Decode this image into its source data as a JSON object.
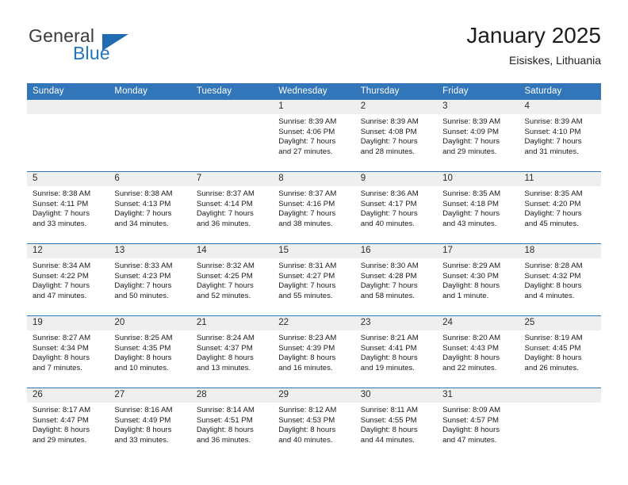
{
  "brand": {
    "name_top": "General",
    "name_bottom": "Blue",
    "triangle_color": "#1f6cb0",
    "blue_text_color": "#2176bd"
  },
  "header": {
    "title": "January 2025",
    "subtitle": "Eisiskes, Lithuania"
  },
  "theme": {
    "header_blue": "#3275b8",
    "row_separator": "#2f74b4",
    "daynum_background": "#efefef"
  },
  "weekday_headers": [
    "Sunday",
    "Monday",
    "Tuesday",
    "Wednesday",
    "Thursday",
    "Friday",
    "Saturday"
  ],
  "weeks": [
    [
      {
        "day": "",
        "lines": []
      },
      {
        "day": "",
        "lines": []
      },
      {
        "day": "",
        "lines": []
      },
      {
        "day": "1",
        "lines": [
          "Sunrise: 8:39 AM",
          "Sunset: 4:06 PM",
          "Daylight: 7 hours",
          "and 27 minutes."
        ]
      },
      {
        "day": "2",
        "lines": [
          "Sunrise: 8:39 AM",
          "Sunset: 4:08 PM",
          "Daylight: 7 hours",
          "and 28 minutes."
        ]
      },
      {
        "day": "3",
        "lines": [
          "Sunrise: 8:39 AM",
          "Sunset: 4:09 PM",
          "Daylight: 7 hours",
          "and 29 minutes."
        ]
      },
      {
        "day": "4",
        "lines": [
          "Sunrise: 8:39 AM",
          "Sunset: 4:10 PM",
          "Daylight: 7 hours",
          "and 31 minutes."
        ]
      }
    ],
    [
      {
        "day": "5",
        "lines": [
          "Sunrise: 8:38 AM",
          "Sunset: 4:11 PM",
          "Daylight: 7 hours",
          "and 33 minutes."
        ]
      },
      {
        "day": "6",
        "lines": [
          "Sunrise: 8:38 AM",
          "Sunset: 4:13 PM",
          "Daylight: 7 hours",
          "and 34 minutes."
        ]
      },
      {
        "day": "7",
        "lines": [
          "Sunrise: 8:37 AM",
          "Sunset: 4:14 PM",
          "Daylight: 7 hours",
          "and 36 minutes."
        ]
      },
      {
        "day": "8",
        "lines": [
          "Sunrise: 8:37 AM",
          "Sunset: 4:16 PM",
          "Daylight: 7 hours",
          "and 38 minutes."
        ]
      },
      {
        "day": "9",
        "lines": [
          "Sunrise: 8:36 AM",
          "Sunset: 4:17 PM",
          "Daylight: 7 hours",
          "and 40 minutes."
        ]
      },
      {
        "day": "10",
        "lines": [
          "Sunrise: 8:35 AM",
          "Sunset: 4:18 PM",
          "Daylight: 7 hours",
          "and 43 minutes."
        ]
      },
      {
        "day": "11",
        "lines": [
          "Sunrise: 8:35 AM",
          "Sunset: 4:20 PM",
          "Daylight: 7 hours",
          "and 45 minutes."
        ]
      }
    ],
    [
      {
        "day": "12",
        "lines": [
          "Sunrise: 8:34 AM",
          "Sunset: 4:22 PM",
          "Daylight: 7 hours",
          "and 47 minutes."
        ]
      },
      {
        "day": "13",
        "lines": [
          "Sunrise: 8:33 AM",
          "Sunset: 4:23 PM",
          "Daylight: 7 hours",
          "and 50 minutes."
        ]
      },
      {
        "day": "14",
        "lines": [
          "Sunrise: 8:32 AM",
          "Sunset: 4:25 PM",
          "Daylight: 7 hours",
          "and 52 minutes."
        ]
      },
      {
        "day": "15",
        "lines": [
          "Sunrise: 8:31 AM",
          "Sunset: 4:27 PM",
          "Daylight: 7 hours",
          "and 55 minutes."
        ]
      },
      {
        "day": "16",
        "lines": [
          "Sunrise: 8:30 AM",
          "Sunset: 4:28 PM",
          "Daylight: 7 hours",
          "and 58 minutes."
        ]
      },
      {
        "day": "17",
        "lines": [
          "Sunrise: 8:29 AM",
          "Sunset: 4:30 PM",
          "Daylight: 8 hours",
          "and 1 minute."
        ]
      },
      {
        "day": "18",
        "lines": [
          "Sunrise: 8:28 AM",
          "Sunset: 4:32 PM",
          "Daylight: 8 hours",
          "and 4 minutes."
        ]
      }
    ],
    [
      {
        "day": "19",
        "lines": [
          "Sunrise: 8:27 AM",
          "Sunset: 4:34 PM",
          "Daylight: 8 hours",
          "and 7 minutes."
        ]
      },
      {
        "day": "20",
        "lines": [
          "Sunrise: 8:25 AM",
          "Sunset: 4:35 PM",
          "Daylight: 8 hours",
          "and 10 minutes."
        ]
      },
      {
        "day": "21",
        "lines": [
          "Sunrise: 8:24 AM",
          "Sunset: 4:37 PM",
          "Daylight: 8 hours",
          "and 13 minutes."
        ]
      },
      {
        "day": "22",
        "lines": [
          "Sunrise: 8:23 AM",
          "Sunset: 4:39 PM",
          "Daylight: 8 hours",
          "and 16 minutes."
        ]
      },
      {
        "day": "23",
        "lines": [
          "Sunrise: 8:21 AM",
          "Sunset: 4:41 PM",
          "Daylight: 8 hours",
          "and 19 minutes."
        ]
      },
      {
        "day": "24",
        "lines": [
          "Sunrise: 8:20 AM",
          "Sunset: 4:43 PM",
          "Daylight: 8 hours",
          "and 22 minutes."
        ]
      },
      {
        "day": "25",
        "lines": [
          "Sunrise: 8:19 AM",
          "Sunset: 4:45 PM",
          "Daylight: 8 hours",
          "and 26 minutes."
        ]
      }
    ],
    [
      {
        "day": "26",
        "lines": [
          "Sunrise: 8:17 AM",
          "Sunset: 4:47 PM",
          "Daylight: 8 hours",
          "and 29 minutes."
        ]
      },
      {
        "day": "27",
        "lines": [
          "Sunrise: 8:16 AM",
          "Sunset: 4:49 PM",
          "Daylight: 8 hours",
          "and 33 minutes."
        ]
      },
      {
        "day": "28",
        "lines": [
          "Sunrise: 8:14 AM",
          "Sunset: 4:51 PM",
          "Daylight: 8 hours",
          "and 36 minutes."
        ]
      },
      {
        "day": "29",
        "lines": [
          "Sunrise: 8:12 AM",
          "Sunset: 4:53 PM",
          "Daylight: 8 hours",
          "and 40 minutes."
        ]
      },
      {
        "day": "30",
        "lines": [
          "Sunrise: 8:11 AM",
          "Sunset: 4:55 PM",
          "Daylight: 8 hours",
          "and 44 minutes."
        ]
      },
      {
        "day": "31",
        "lines": [
          "Sunrise: 8:09 AM",
          "Sunset: 4:57 PM",
          "Daylight: 8 hours",
          "and 47 minutes."
        ]
      },
      {
        "day": "",
        "lines": []
      }
    ]
  ]
}
